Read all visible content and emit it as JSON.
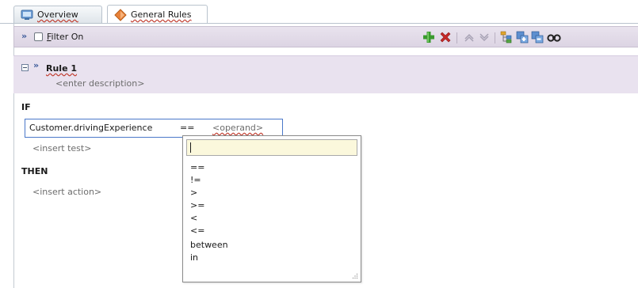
{
  "tabs": [
    {
      "label": "Overview",
      "active": false,
      "icon": "overview-icon"
    },
    {
      "label": "General Rules",
      "active": true,
      "icon": "rules-diamond-icon"
    }
  ],
  "toolbar": {
    "filter_label_accel": "F",
    "filter_label_rest": "ilter On",
    "filter_checked": false,
    "icons": [
      "expand-chevron-icon",
      "add-icon",
      "delete-icon",
      "move-up-icon",
      "move-down-icon",
      "tree-icon",
      "copy-icon",
      "paste-icon",
      "find-icon"
    ]
  },
  "rule": {
    "name": "Rule 1",
    "description_placeholder": "<enter description>"
  },
  "if_keyword": "IF",
  "test": {
    "expression": "Customer.drivingExperience",
    "operator": "==",
    "operand_placeholder": "<operand>"
  },
  "insert_test_placeholder": "<insert test>",
  "then_keyword": "THEN",
  "insert_action_placeholder": "<insert action>",
  "operator_dropdown": {
    "input_value": "",
    "options": [
      "==",
      "!=",
      ">",
      ">=",
      "<",
      "<=",
      "between",
      "in"
    ]
  },
  "colors": {
    "add": "#3a9a2e",
    "delete": "#c62828",
    "focus_border": "#4a78c9",
    "rule_header_bg": "#e9e2ef",
    "popup_input_bg": "#fbf8dc"
  }
}
